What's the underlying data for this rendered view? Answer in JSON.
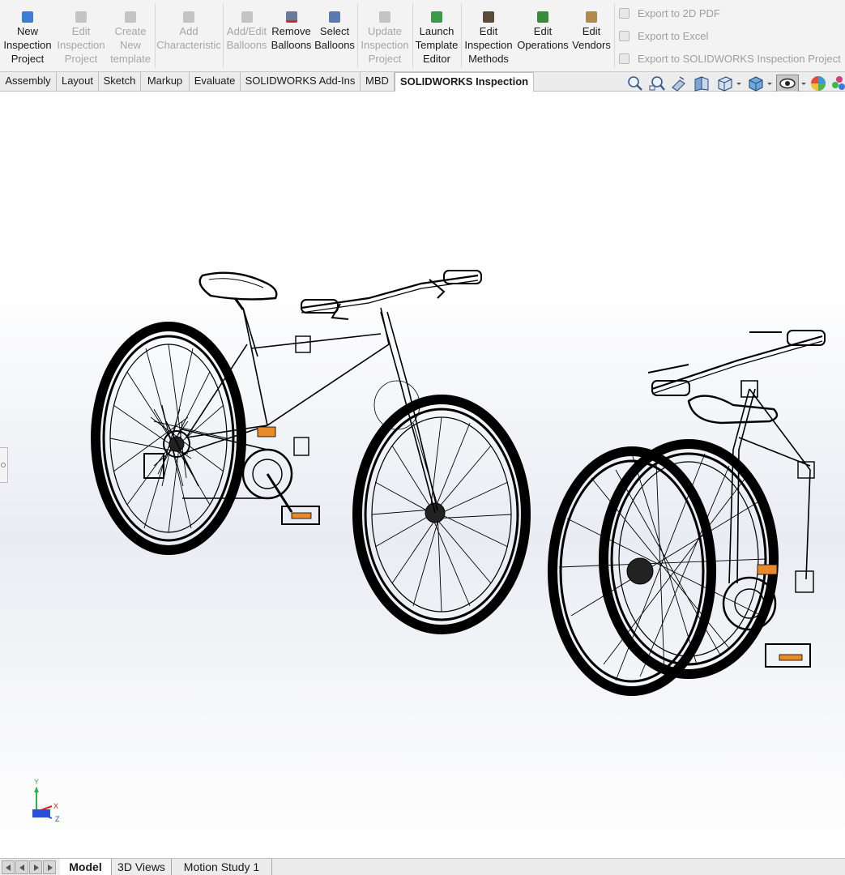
{
  "ribbon": {
    "buttons": [
      {
        "label": "New\nInspection\nProject",
        "enabled": true,
        "icon": "new-inspection-project-icon"
      },
      {
        "label": "Edit\nInspection\nProject",
        "enabled": false,
        "icon": "edit-inspection-project-icon"
      },
      {
        "label": "Create\nNew\ntemplate",
        "enabled": false,
        "icon": "create-template-icon"
      },
      {
        "label": "Add\nCharacteristic",
        "enabled": false,
        "icon": "add-characteristic-icon"
      },
      {
        "label": "Add/Edit\nBalloons",
        "enabled": false,
        "icon": "balloons-icon"
      },
      {
        "label": "Remove\nBalloons",
        "enabled": true,
        "icon": "remove-balloons-icon"
      },
      {
        "label": "Select\nBalloons",
        "enabled": true,
        "icon": "select-balloons-icon"
      },
      {
        "label": "Update\nInspection\nProject",
        "enabled": false,
        "icon": "update-project-icon"
      },
      {
        "label": "Launch\nTemplate\nEditor",
        "enabled": true,
        "icon": "template-editor-icon"
      },
      {
        "label": "Edit\nInspection\nMethods",
        "enabled": true,
        "icon": "inspection-methods-icon"
      },
      {
        "label": "Edit\nOperations",
        "enabled": true,
        "icon": "operations-icon"
      },
      {
        "label": "Edit\nVendors",
        "enabled": true,
        "icon": "vendors-icon"
      }
    ],
    "exports": [
      {
        "label": "Export to 2D PDF",
        "enabled": false,
        "icon": "pdf-export-icon"
      },
      {
        "label": "Export to Excel",
        "enabled": false,
        "icon": "excel-export-icon"
      },
      {
        "label": "Export to SOLIDWORKS Inspection Project",
        "enabled": false,
        "icon": "inspection-export-icon"
      }
    ]
  },
  "tabs": [
    "Assembly",
    "Layout",
    "Sketch",
    "Markup",
    "Evaluate",
    "SOLIDWORKS Add-Ins",
    "MBD",
    "SOLIDWORKS Inspection"
  ],
  "active_tab": "SOLIDWORKS Inspection",
  "view_toolbar": [
    "zoom-to-fit-icon",
    "zoom-to-area-icon",
    "previous-view-icon",
    "section-view-icon",
    "view-orientation-icon",
    "display-style-icon",
    "hide-show-items-icon",
    "edit-appearance-icon",
    "apply-scene-icon"
  ],
  "triad": {
    "y": "Y",
    "x": "X",
    "z": "Z"
  },
  "bottom_tabs": [
    "Model",
    "3D Views",
    "Motion Study 1"
  ],
  "active_bottom_tab": "Model",
  "colors": {
    "ribbon_bg": "#f3f3f3",
    "triad_y": "#2db34a",
    "triad_x": "#e02020",
    "triad_z": "#2a4fd8",
    "pedal_accent": "#e8892a"
  }
}
